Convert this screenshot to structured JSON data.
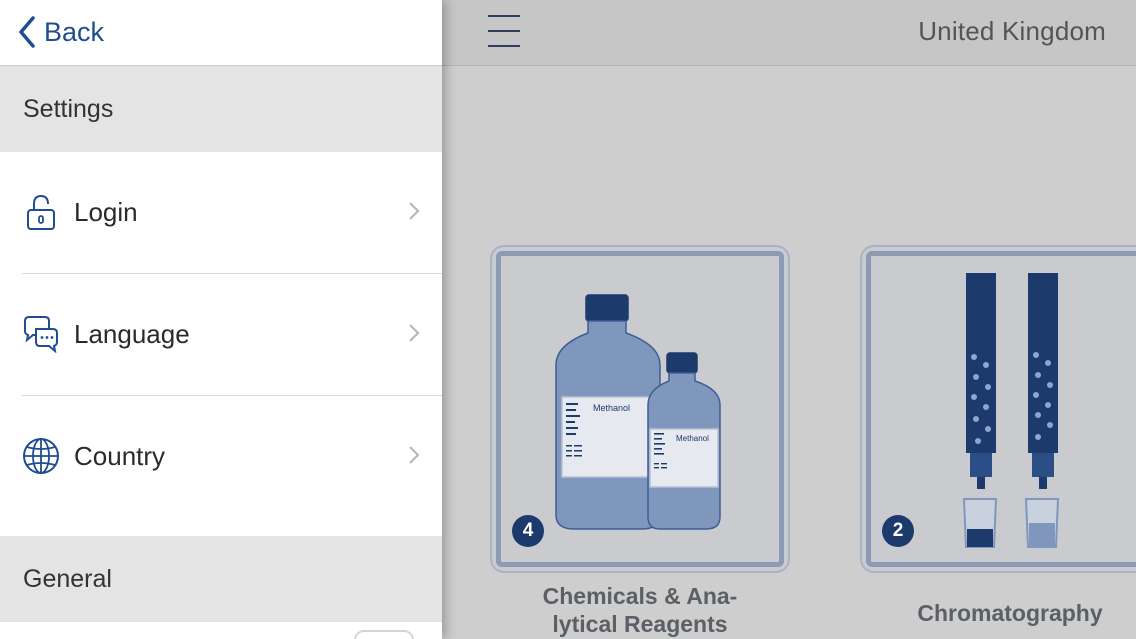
{
  "nav": {
    "back_label": "Back"
  },
  "settings_panel": {
    "section_settings": "Settings",
    "items": [
      {
        "label": "Login",
        "icon": "lock-icon"
      },
      {
        "label": "Language",
        "icon": "speech-bubbles-icon"
      },
      {
        "label": "Country",
        "icon": "globe-icon"
      }
    ],
    "section_general": "General"
  },
  "main": {
    "country": "United Kingdom",
    "tiles": [
      {
        "label": "Chemicals & Ana-\nlytical Reagents",
        "count": "4",
        "image": "reagent-bottles",
        "bottle_label_large": "Methanol",
        "bottle_label_small": "Methanol"
      },
      {
        "label": "Chromatography",
        "count": "2",
        "image": "chromatography-columns"
      }
    ]
  },
  "colors": {
    "accent": "#1f4d8f",
    "badge": "#1c3a6b",
    "section_background": "#e4e4e4",
    "illustration_blue": "#1c3a6b"
  }
}
